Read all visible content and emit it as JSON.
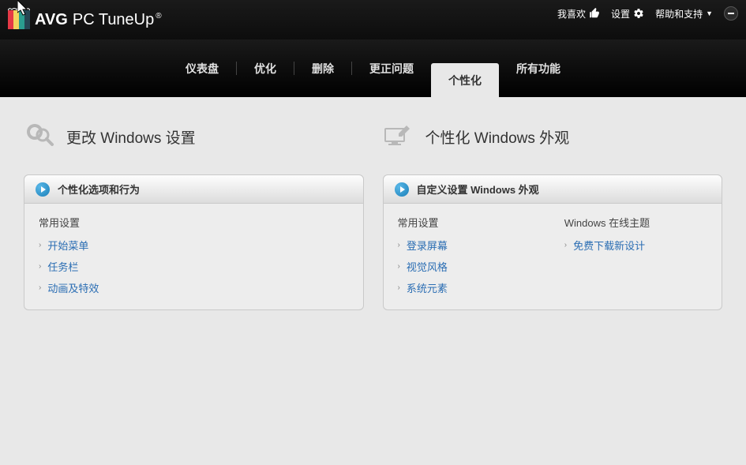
{
  "top_right": {
    "like": "我喜欢",
    "settings": "设置",
    "help": "帮助和支持"
  },
  "brand": {
    "avg": "AVG",
    "product": "PC TuneUp"
  },
  "tabs": {
    "dashboard": "仪表盘",
    "optimize": "优化",
    "delete": "删除",
    "fix": "更正问题",
    "personalize": "个性化",
    "all": "所有功能"
  },
  "left": {
    "section_title": "更改 Windows 设置",
    "panel_title": "个性化选项和行为",
    "sub": "常用设置",
    "links": {
      "start_menu": "开始菜单",
      "taskbar": "任务栏",
      "animations": "动画及特效"
    }
  },
  "right": {
    "section_title": "个性化 Windows 外观",
    "panel_title": "自定义设置 Windows 外观",
    "sub_left": "常用设置",
    "sub_right": "Windows 在线主题",
    "links_left": {
      "login_screen": "登录屏幕",
      "visual_style": "视觉风格",
      "system_elements": "系统元素"
    },
    "links_right": {
      "free_download": "免费下载新设计"
    }
  }
}
